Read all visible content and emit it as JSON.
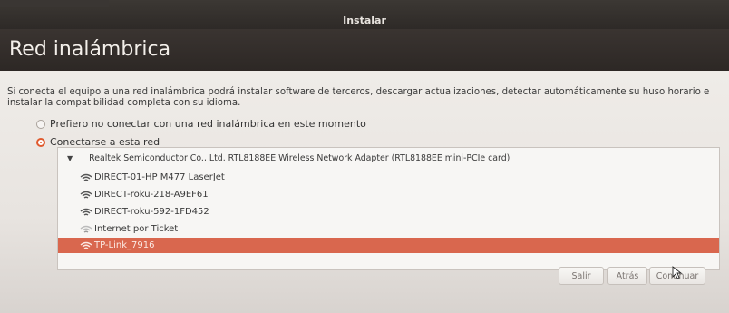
{
  "window": {
    "title": "Instalar"
  },
  "header": {
    "title": "Red inalámbrica"
  },
  "description": "Si conecta el equipo a una red inalámbrica podrá instalar software de terceros, descargar actualizaciones, detectar automáticamente su huso horario e instalar la compatibilidad completa con su idioma.",
  "options": {
    "no_connect": "Prefiero no conectar con una red inalámbrica en este momento",
    "connect": "Conectarse a esta red"
  },
  "networks": {
    "adapter": "Realtek Semiconductor Co., Ltd. RTL8188EE Wireless Network Adapter (RTL8188EE mini-PCIe card)",
    "items": [
      {
        "name": "DIRECT-01-HP M477 LaserJet",
        "icon": "wifi-icon",
        "selected": false
      },
      {
        "name": "DIRECT-roku-218-A9EF61",
        "icon": "wifi-icon",
        "selected": false
      },
      {
        "name": "DIRECT-roku-592-1FD452",
        "icon": "wifi-icon",
        "selected": false
      },
      {
        "name": "Internet por Ticket",
        "icon": "wifi-weak-icon",
        "selected": false
      },
      {
        "name": "TP-Link_7916",
        "icon": "wifi-icon",
        "selected": true
      }
    ]
  },
  "buttons": {
    "quit": "Salir",
    "back": "Atrás",
    "continue": "Continuar"
  },
  "colors": {
    "accent": "#e05a2e",
    "selection": "#d9674e",
    "header_bg": "#2d2825"
  }
}
